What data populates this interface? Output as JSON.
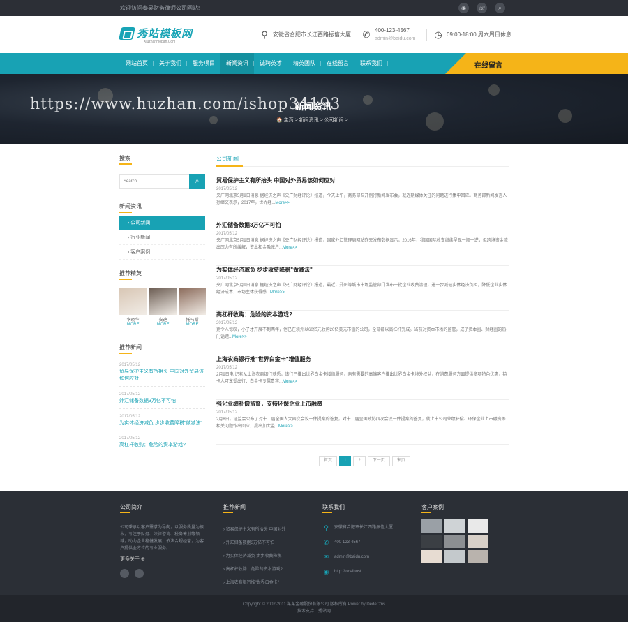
{
  "topbar": {
    "slogan": "欢迎访问泰昊财务律师公司网站!",
    "icons": [
      "weibo-icon",
      "wechat-icon",
      "search-icon"
    ]
  },
  "header": {
    "logo_text": "秀站模板网",
    "logo_sub": "Xiuzhanmoban.Com",
    "address": "安徽省合肥市长江西路振信大厦",
    "phone": "400-123-4567",
    "email": "admin@baidu.com",
    "hours": "09:00-18:00 周六周日休息"
  },
  "nav": {
    "items": [
      "网站首页",
      "关于我们",
      "服务项目",
      "新闻资讯",
      "诚聘英才",
      "精英团队",
      "在线留言",
      "联系我们"
    ],
    "active_index": 3,
    "message_label": "在线留言"
  },
  "banner": {
    "title": "新闻资讯",
    "breadcrumb": "🏠 主页 > 新闻资讯 > 公司新闻 >"
  },
  "watermark": "https://www.huzhan.com/ishop34193",
  "sidebar": {
    "search_title": "搜索",
    "search_placeholder": "Search",
    "news_title": "新闻资讯",
    "categories": [
      "公司新闻",
      "行业新闻",
      "客户案例"
    ],
    "active_category": 0,
    "recommend_title": "推荐精英",
    "people": [
      {
        "name": "李晓华",
        "more": "MORE",
        "color": "#d8c6b4"
      },
      {
        "name": "安迪",
        "more": "MORE",
        "color": "#6b5c52"
      },
      {
        "name": "托马斯",
        "more": "MORE",
        "color": "#8a6a5a"
      }
    ],
    "rec_news_title": "推荐新闻",
    "rec_news": [
      {
        "date": "2017/05/12",
        "title": "贸易保护主义有所抬头 中国对外贸易该如何应对"
      },
      {
        "date": "2017/05/12",
        "title": "外汇储备数据3万亿不可怕"
      },
      {
        "date": "2017/05/12",
        "title": "为实体经济减负 步步收费降税\"做减法\""
      },
      {
        "date": "2017/05/12",
        "title": "高杠杆收购：危险的资本游戏?"
      }
    ]
  },
  "main": {
    "title": "公司新闻",
    "more_label": "More>>",
    "news": [
      {
        "title": "贸易保护主义有所抬头 中国对外贸易该如何应对",
        "date": "2017/05/12",
        "excerpt": "央广网北京5月9日消息 据经济之声《央广财经评论》报道，今天上午，商务部召开例行新闻发布会，就近期媒体关注的问题进行集中回应。商务部新闻发言人孙继文表示，2017年，世界经..."
      },
      {
        "title": "外汇储备数据3万亿不可怕",
        "date": "2017/05/12",
        "excerpt": "央广网北京5月9日消息 据经济之声《央广财经评论》报道，国家外汇管理局网站昨天发布数据显示，2016年，我国国际收支继续呈现一顺一逆，但跨境资金流出压力有所缓解，资本和金融账户..."
      },
      {
        "title": "为实体经济减负 步步收费降税\"做减法\"",
        "date": "2017/05/12",
        "excerpt": "央广网北京5月9日消息 据经济之声《央广财经评论》报道，最近，郑州等城市市场监管部门发布一批企业收费清理，进一步减轻实体经济负担，降低企业实体经济成本，市场主体获得感..."
      },
      {
        "title": "高杠杆收购：危险的资本游戏?",
        "date": "2017/05/12",
        "excerpt": "更令人惊叹，小子才开展不到两年，他已在境外以60亿元收购20亿美元市值的公司，全部都以高杠杆完成。当前对资本市场的监管，成了资本圈、财经圈的热门话题..."
      },
      {
        "title": "上海农商银行推\"世界白金卡\"增值服务",
        "date": "2017/05/12",
        "excerpt": "2月9日电 记者从上海农商银行获悉，该行已推出世界白金卡增值服务，向有需要的高端客户推出世界白金卡境外权益，在消费服务方面提供多项特色优惠，持卡人可享受出行、白金卡专属贵宾..."
      },
      {
        "title": "强化业绩补偿监督，支持环保企业上市融资",
        "date": "2017/05/12",
        "excerpt": "2月8日，证监会公布了对十二届全国人大四次会议一件提案的答复，对十二届全国政协四次会议一件提案的答复，就上市公司业绩补偿、环保企业上市融资等相关问题作出回应，提出加大监..."
      }
    ],
    "pager": [
      "首页",
      "1",
      "2",
      "下一页",
      "末页"
    ],
    "pager_active": 1
  },
  "footer": {
    "intro_title": "公司简介",
    "intro_text": "公司秉承以客户需求为导向，以服务质量为根本，专注于财务、法律咨询、税务筹划等领域，助力企业稳健发展，依法合规经营，为客户提供全方位的专业服务。",
    "intro_more": "更多关于 ⊕",
    "news_title": "推荐新闻",
    "news_items": [
      "贸易保护主义有所抬头 中国对外",
      "外汇储备数据3万亿不可怕",
      "为实体经济减负 步步收费降税",
      "高杠杆收购：危险的资本游戏?",
      "上海农商银行推\"世界白金卡\""
    ],
    "contact_title": "联系我们",
    "contact": [
      {
        "icon": "location-icon",
        "glyph": "⚲",
        "text": "安徽省合肥市长江西路振信大厦"
      },
      {
        "icon": "phone-icon",
        "glyph": "✆",
        "text": "400-123-4567"
      },
      {
        "icon": "mail-icon",
        "glyph": "✉",
        "text": "admin@baidu.com"
      },
      {
        "icon": "web-icon",
        "glyph": "◉",
        "text": "http://localhost"
      }
    ],
    "cases_title": "客户案例",
    "case_colors": [
      "#9aa0a6",
      "#cfd3d6",
      "#e9e9e9",
      "#3b3f44",
      "#8c8f92",
      "#d8d0c8",
      "#e7dcd2",
      "#c4c9cc",
      "#b9b3ad"
    ],
    "copyright": "Copyright © 2002-2011 某某金融股份有限公司 版权所有 Power by DedeCms",
    "support": "技术支持：秀站网"
  }
}
